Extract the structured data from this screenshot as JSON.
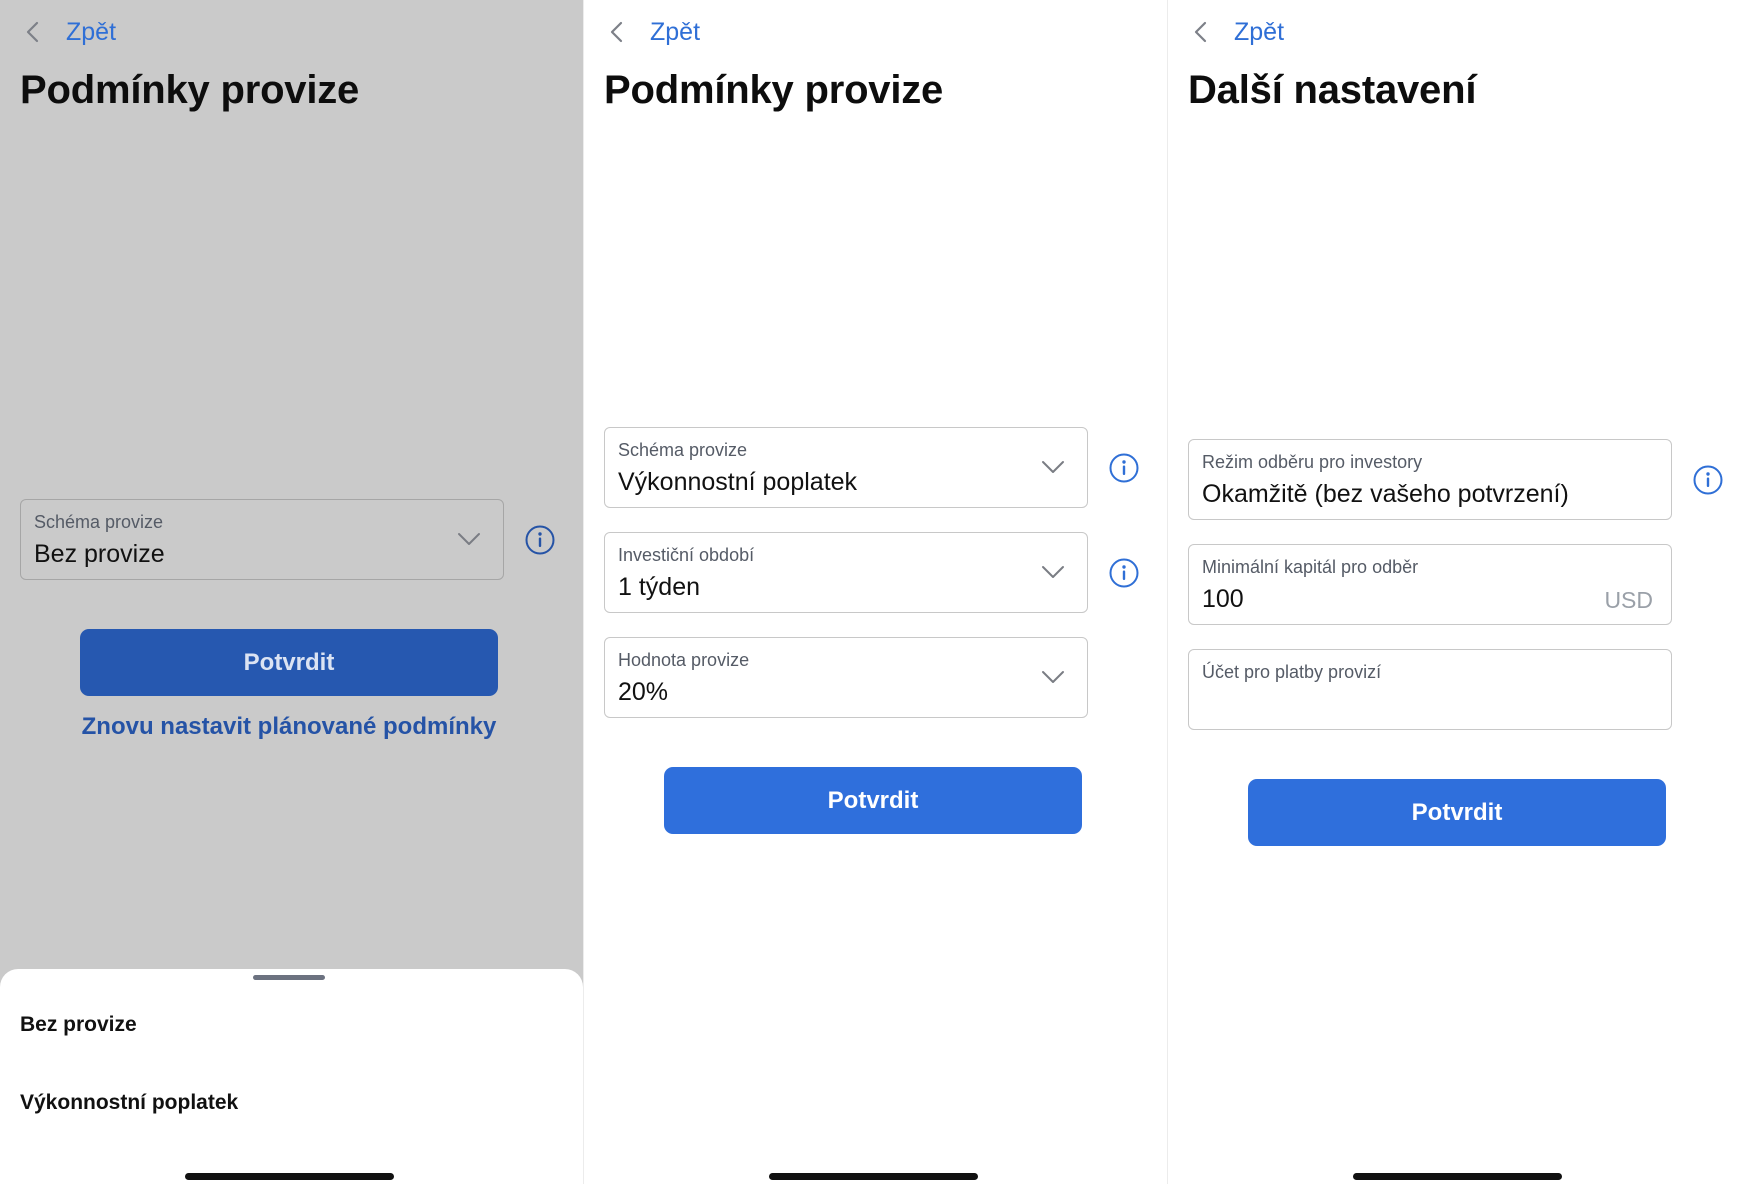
{
  "colors": {
    "accent": "#2f6fdc",
    "link": "#2f6fd6",
    "dimmed_overlay": "#cacaca",
    "info_icon": "#2f6fd6"
  },
  "panel1": {
    "back_label": "Zpět",
    "title": "Podmínky provize",
    "commission_scheme": {
      "label": "Schéma provize",
      "value": "Bez provize",
      "icon": "chevron-down-icon"
    },
    "confirm_label": "Potvrdit",
    "reset_link_label": "Znovu nastavit plánované podmínky",
    "sheet": {
      "options": [
        "Bez provize",
        "Výkonnostní poplatek"
      ]
    }
  },
  "panel2": {
    "back_label": "Zpět",
    "title": "Podmínky provize",
    "commission_scheme": {
      "label": "Schéma provize",
      "value": "Výkonnostní poplatek"
    },
    "investment_period": {
      "label": "Investiční období",
      "value": "1 týden"
    },
    "commission_value": {
      "label": "Hodnota provize",
      "value": "20%"
    },
    "confirm_label": "Potvrdit"
  },
  "panel3": {
    "back_label": "Zpět",
    "title": "Další nastavení",
    "subscription_mode": {
      "label": "Režim odběru pro investory",
      "value": "Okamžitě (bez vašeho potvrzení)"
    },
    "min_capital": {
      "label": "Minimální kapitál pro odběr",
      "value": "100",
      "currency": "USD"
    },
    "payout_account": {
      "label": "Účet pro platby provizí",
      "value": ""
    },
    "confirm_label": "Potvrdit"
  }
}
